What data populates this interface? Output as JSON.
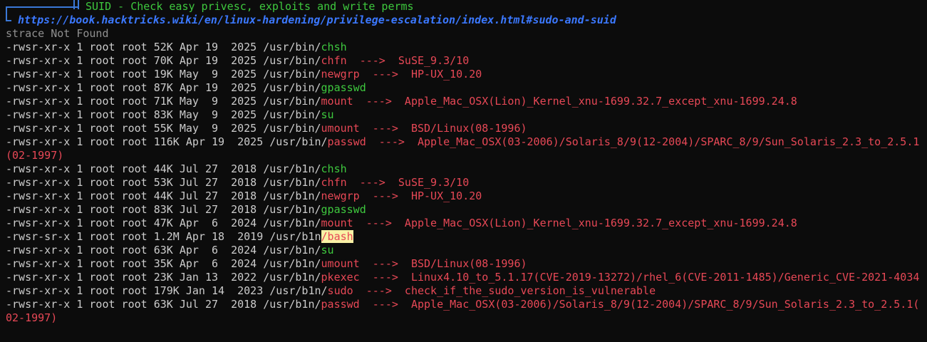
{
  "header": {
    "title": "SUID - Check easy privesc, exploits and write perms",
    "url": "https://book.hacktricks.wiki/en/linux-hardening/privilege-escalation/index.html#sudo-and-suid"
  },
  "notice": "strace Not Found",
  "rows": [
    {
      "meta": "-rwsr-xr-x 1 root root 52K Apr 19  2025 /usr/bin/",
      "file": "chsh",
      "color": "green",
      "exploit": ""
    },
    {
      "meta": "-rwsr-xr-x 1 root root 70K Apr 19  2025 /usr/bin/",
      "file": "chfn",
      "color": "red",
      "exploit": "  --->  SuSE_9.3/10"
    },
    {
      "meta": "-rwsr-xr-x 1 root root 19K May  9  2025 /usr/bin/",
      "file": "newgrp",
      "color": "red",
      "exploit": "  --->  HP-UX_10.20"
    },
    {
      "meta": "-rwsr-xr-x 1 root root 87K Apr 19  2025 /usr/bin/",
      "file": "gpasswd",
      "color": "green",
      "exploit": ""
    },
    {
      "meta": "-rwsr-xr-x 1 root root 71K May  9  2025 /usr/bin/",
      "file": "mount",
      "color": "red",
      "exploit": "  --->  Apple_Mac_OSX(Lion)_Kernel_xnu-1699.32.7_except_xnu-1699.24.8"
    },
    {
      "meta": "-rwsr-xr-x 1 root root 83K May  9  2025 /usr/bin/",
      "file": "su",
      "color": "green",
      "exploit": ""
    },
    {
      "meta": "-rwsr-xr-x 1 root root 55K May  9  2025 /usr/bin/",
      "file": "umount",
      "color": "red",
      "exploit": "  --->  BSD/Linux(08-1996)"
    },
    {
      "meta": "-rwsr-xr-x 1 root root 116K Apr 19  2025 /usr/bin/",
      "file": "passwd",
      "color": "red",
      "exploit": "  --->  Apple_Mac_OSX(03-2006)/Solaris_8/9(12-2004)/SPARC_8/9/Sun_Solaris_2.3_to_2.5.1",
      "wrap": "(02-1997)"
    },
    {
      "meta": "-rwsr-xr-x 1 root root 44K Jul 27  2018 /usr/b1n/",
      "file": "chsh",
      "color": "green",
      "exploit": ""
    },
    {
      "meta": "-rwsr-xr-x 1 root root 53K Jul 27  2018 /usr/b1n/",
      "file": "chfn",
      "color": "red",
      "exploit": "  --->  SuSE_9.3/10"
    },
    {
      "meta": "-rwsr-xr-x 1 root root 44K Jul 27  2018 /usr/b1n/",
      "file": "newgrp",
      "color": "red",
      "exploit": "  --->  HP-UX_10.20"
    },
    {
      "meta": "-rwsr-xr-x 1 root root 83K Jul 27  2018 /usr/b1n/",
      "file": "gpasswd",
      "color": "green",
      "exploit": ""
    },
    {
      "meta": "-rwsr-xr-x 1 root root 47K Apr  6  2024 /usr/b1n/",
      "file": "mount",
      "color": "red",
      "exploit": "  --->  Apple_Mac_OSX(Lion)_Kernel_xnu-1699.32.7_except_xnu-1699.24.8"
    },
    {
      "meta": "-rwsr-sr-x 1 root root 1.2M Apr 18  2019 /usr/b1n",
      "file": "/bash",
      "color": "hl",
      "exploit": ""
    },
    {
      "meta": "-rwsr-xr-x 1 root root 63K Apr  6  2024 /usr/b1n/",
      "file": "su",
      "color": "green",
      "exploit": ""
    },
    {
      "meta": "-rwsr-xr-x 1 root root 35K Apr  6  2024 /usr/b1n/",
      "file": "umount",
      "color": "red",
      "exploit": "  --->  BSD/Linux(08-1996)"
    },
    {
      "meta": "-rwsr-xr-x 1 root root 23K Jan 13  2022 /usr/b1n/",
      "file": "pkexec",
      "color": "red",
      "exploit": "  --->  Linux4.10_to_5.1.17(CVE-2019-13272)/rhel_6(CVE-2011-1485)/Generic_CVE-2021-4034"
    },
    {
      "meta": "-rwsr-xr-x 1 root root 179K Jan 14  2023 /usr/b1n/",
      "file": "sudo",
      "color": "red",
      "exploit": "  --->  check_if_the_sudo_version_is_vulnerable"
    },
    {
      "meta": "-rwsr-xr-x 1 root root 63K Jul 27  2018 /usr/b1n/",
      "file": "passwd",
      "color": "red",
      "exploit": "  --->  Apple_Mac_OSX(03-2006)/Solaris_8/9(12-2004)/SPARC_8/9/Sun_Solaris_2.3_to_2.5.1(",
      "wrap": "02-1997)"
    }
  ],
  "colors": {
    "background": "#0c0c0c",
    "default_text": "#cccccc",
    "green": "#3ec93e",
    "red": "#e74856",
    "blue": "#3b78ff",
    "highlight_bg": "#f9f1a5",
    "notice_gray": "#909090"
  },
  "icons": {
    "header_box": "box-drawing-bracket-icon",
    "url_corner": "box-drawing-corner-icon"
  }
}
